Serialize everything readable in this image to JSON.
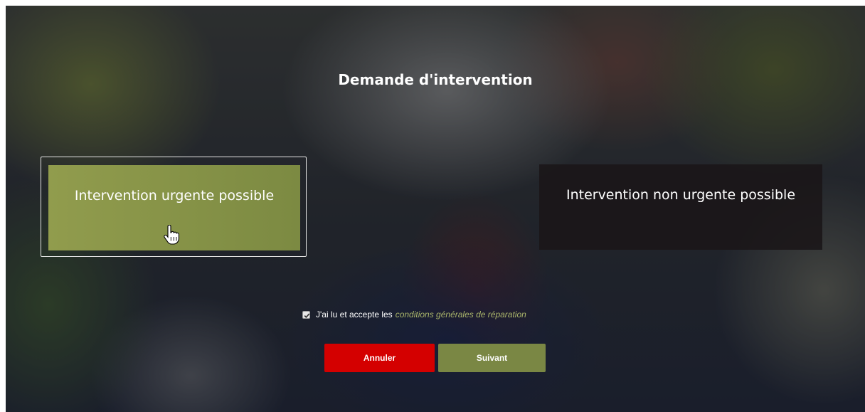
{
  "page": {
    "title": "Demande d'intervention"
  },
  "options": {
    "urgent": {
      "label": "Intervention urgente possible",
      "selected": true
    },
    "non_urgent": {
      "label": "Intervention non urgente possible",
      "selected": false
    }
  },
  "terms": {
    "checked": true,
    "text": "J'ai lu et accepte les",
    "link_text": "conditions générales de réparation"
  },
  "buttons": {
    "cancel_label": "Annuler",
    "next_label": "Suivant"
  },
  "colors": {
    "accent_olive": "#7a8744",
    "cancel_red": "#d40000",
    "link_olive": "#a9b46a"
  },
  "icons": {
    "cursor": "hand-pointer-icon",
    "checkbox": "checkmark-icon"
  }
}
